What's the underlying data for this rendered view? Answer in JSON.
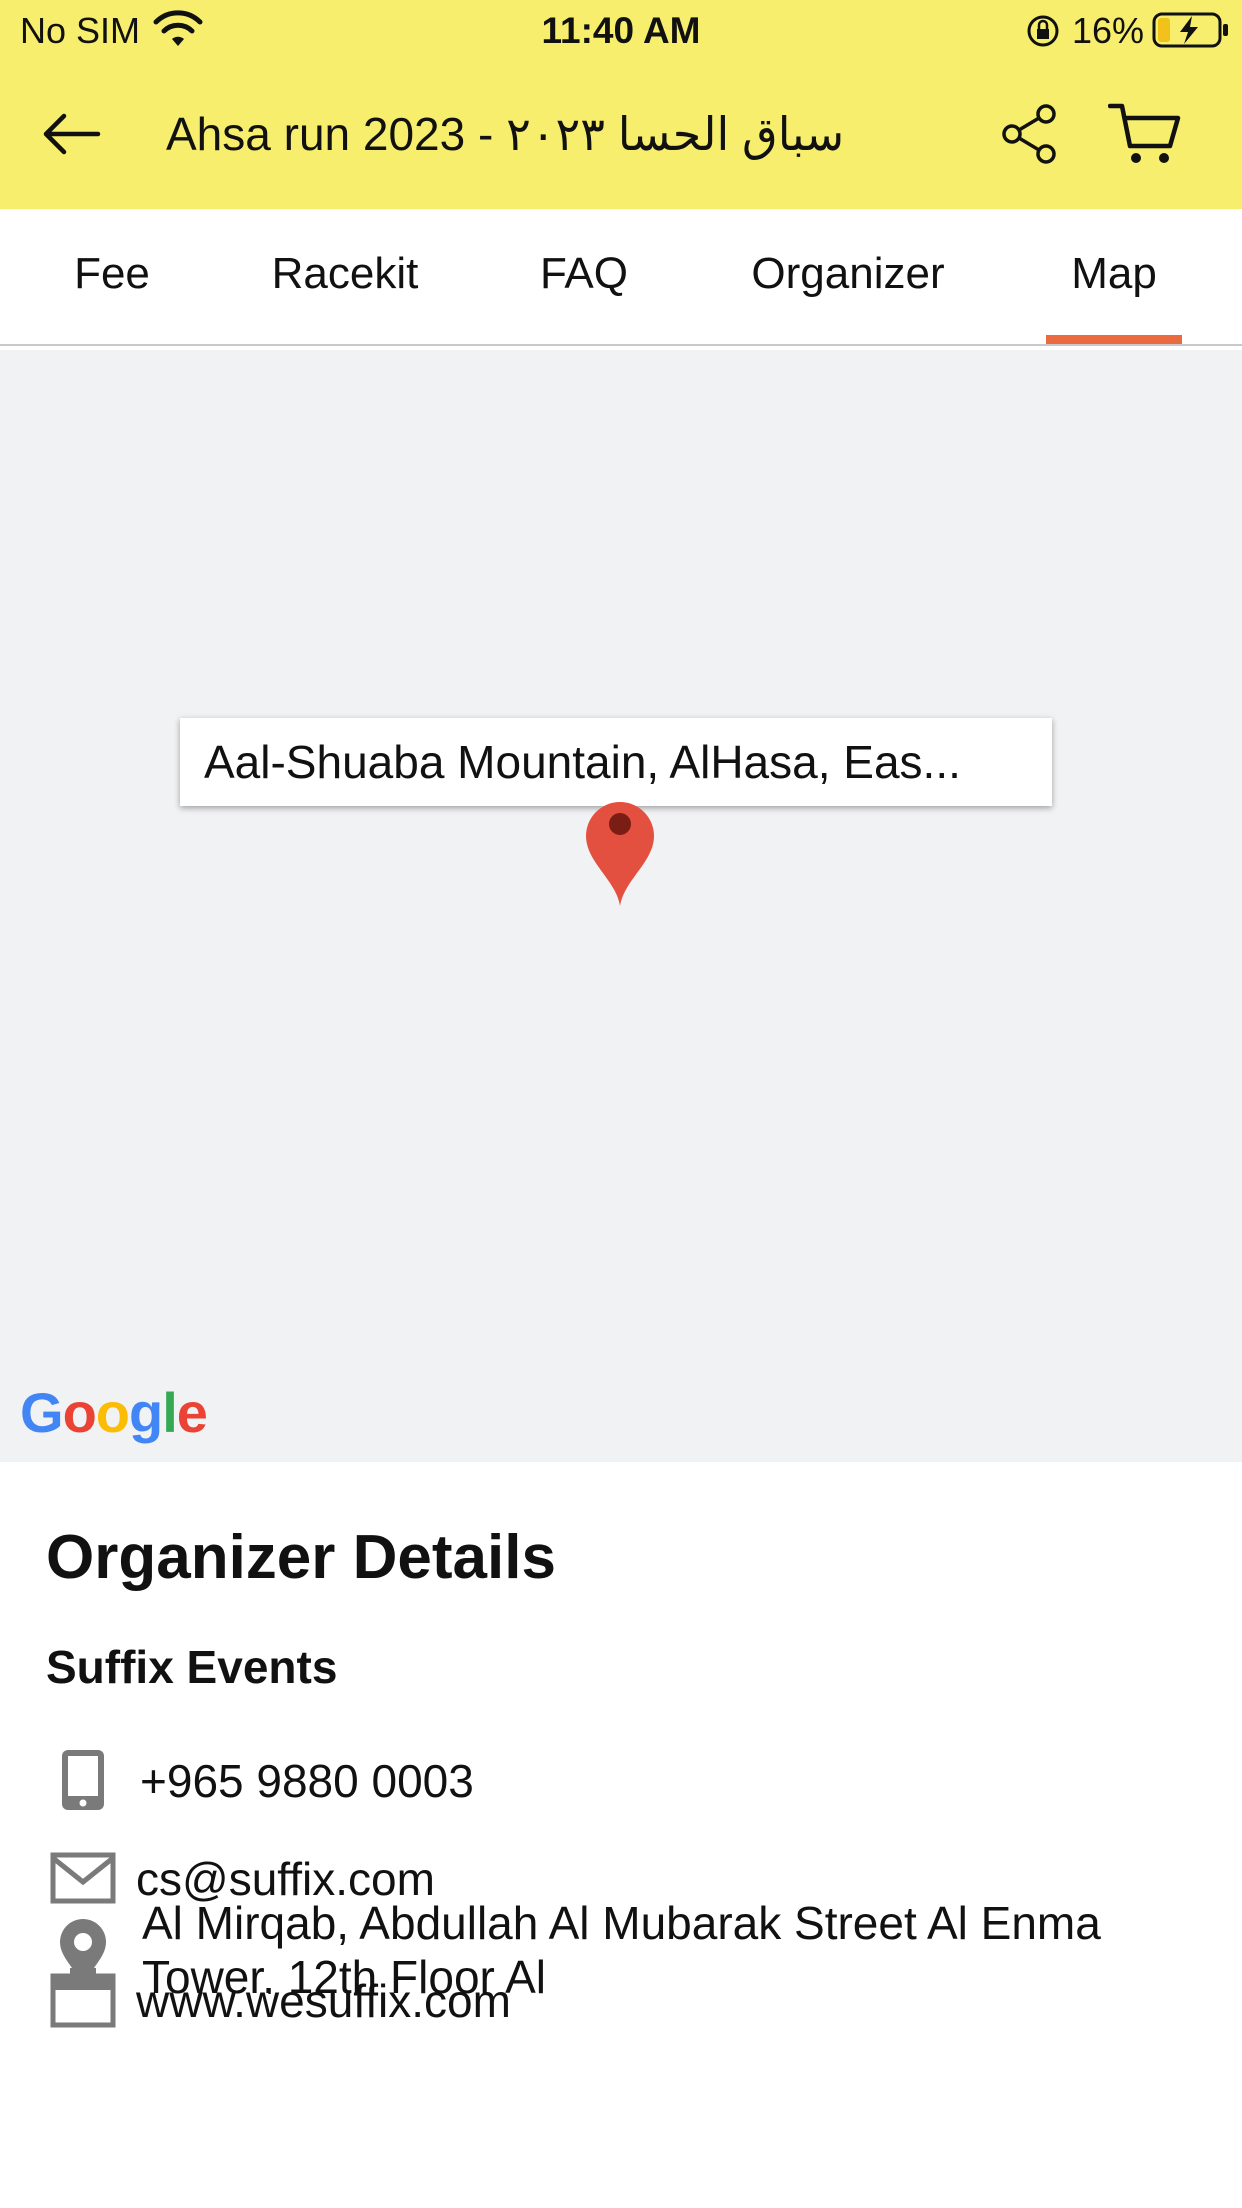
{
  "status_bar": {
    "carrier": "No SIM",
    "time": "11:40 AM",
    "battery_percent": "16%",
    "icons": [
      "wifi-icon",
      "orientation-lock-icon",
      "battery-charging-icon"
    ]
  },
  "header": {
    "title": "Ahsa run 2023 - سباق الحسا ٢٠٢٣",
    "icons": [
      "back-arrow-icon",
      "share-icon",
      "cart-icon"
    ],
    "background_color": "#f6ee6c"
  },
  "tabs": {
    "items": [
      {
        "label": "Fee"
      },
      {
        "label": "Racekit"
      },
      {
        "label": "FAQ"
      },
      {
        "label": "Organizer"
      },
      {
        "label": "Map"
      }
    ],
    "active": "Map",
    "indicator_color": "#ea6b3f"
  },
  "map": {
    "marker_label": "Aal-Shuaba Mountain, AlHasa, Eas...",
    "attribution": "Google",
    "icons": [
      "map-pin-icon"
    ]
  },
  "organizer": {
    "heading": "Organizer Details",
    "name": "Suffix Events",
    "phone": "+965 9880 0003",
    "email": "cs@suffix.com",
    "address": "Al Mirqab, Abdullah Al Mubarak Street Al Enma Tower, 12th Floor Al",
    "website": "www.wesuffix.com",
    "icons": [
      "phone-icon",
      "mail-icon",
      "location-icon",
      "website-icon"
    ]
  }
}
